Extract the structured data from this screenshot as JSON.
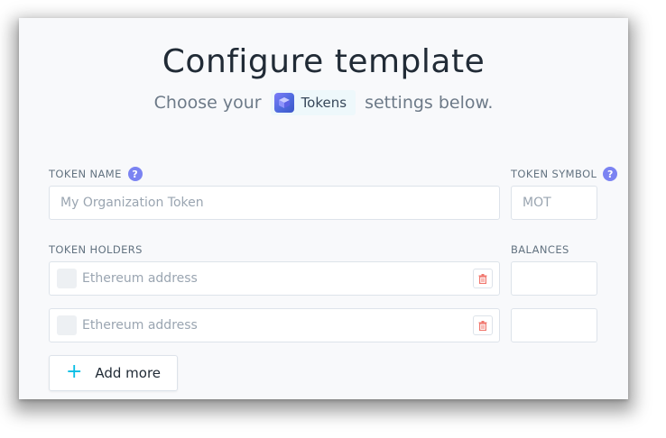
{
  "header": {
    "title": "Configure template",
    "subtitle_prefix": "Choose your",
    "app_name": "Tokens",
    "subtitle_suffix": "settings below."
  },
  "token_name": {
    "label": "TOKEN NAME",
    "help": "?",
    "placeholder": "My Organization Token",
    "value": ""
  },
  "token_symbol": {
    "label": "TOKEN SYMBOL",
    "help": "?",
    "placeholder": "MOT",
    "value": ""
  },
  "holders": {
    "label": "TOKEN HOLDERS",
    "balances_label": "BALANCES",
    "rows": [
      {
        "address_placeholder": "Ethereum address",
        "balance": ""
      },
      {
        "address_placeholder": "Ethereum address",
        "balance": ""
      }
    ],
    "add_more_label": "Add more"
  },
  "colors": {
    "accent": "#08bee5",
    "help_badge": "#7b83f2",
    "trash_icon": "#f0776e"
  }
}
